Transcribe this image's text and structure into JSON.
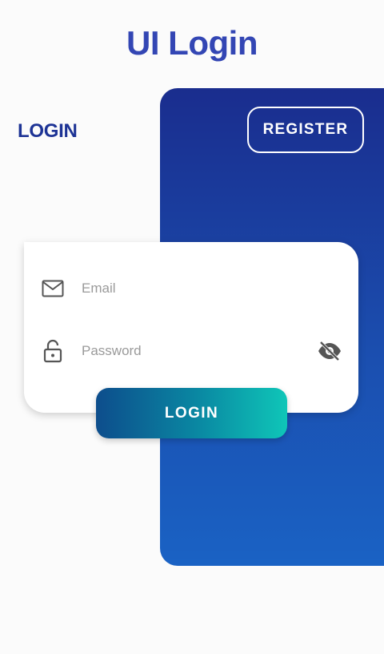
{
  "header": {
    "title": "UI Login"
  },
  "tabs": {
    "login_label": "LOGIN",
    "register_label": "REGISTER"
  },
  "form": {
    "email": {
      "placeholder": "Email",
      "value": "",
      "icon": "mail-icon"
    },
    "password": {
      "placeholder": "Password",
      "value": "",
      "icon": "lock-icon",
      "toggle_icon": "eye-off-icon"
    },
    "submit_label": "LOGIN"
  },
  "colors": {
    "title": "#3346b4",
    "login_tab": "#1d3395",
    "panel_top": "#1a2d8e",
    "panel_bottom": "#1a62c4",
    "button_start": "#0d4d8c",
    "button_end": "#0fc6b8"
  }
}
